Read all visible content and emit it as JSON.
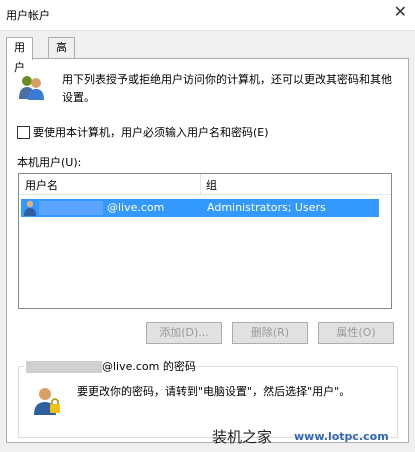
{
  "window": {
    "title": "用户帐户",
    "close_glyph": "✕"
  },
  "tabs": [
    {
      "label": "用户",
      "active": true
    },
    {
      "label": "高级",
      "active": false
    }
  ],
  "info": {
    "text": "用下列表授予或拒绝用户访问你的计算机，还可以更改其密码和其他设置。"
  },
  "require_login": {
    "label": "要使用本计算机，用户必须输入用户名和密码(E)",
    "checked": false
  },
  "local_users": {
    "label": "本机用户(U):",
    "columns": {
      "name": "用户名",
      "group": "组"
    },
    "rows": [
      {
        "user": "@live.com",
        "group": "Administrators; Users",
        "selected": true
      }
    ]
  },
  "buttons": {
    "add": "添加(D)...",
    "remove": "删除(R)",
    "properties": "属性(O)"
  },
  "password_box": {
    "title_prefix": "",
    "title_suffix": "@live.com 的密码",
    "text": "要更改你的密码，请转到\"电脑设置\"，然后选择\"用户\"。"
  },
  "watermark": {
    "text": "装机之家",
    "url": "www.lotpc.com"
  },
  "colors": {
    "selection": "#3399ff",
    "accent": "#3367b3"
  }
}
